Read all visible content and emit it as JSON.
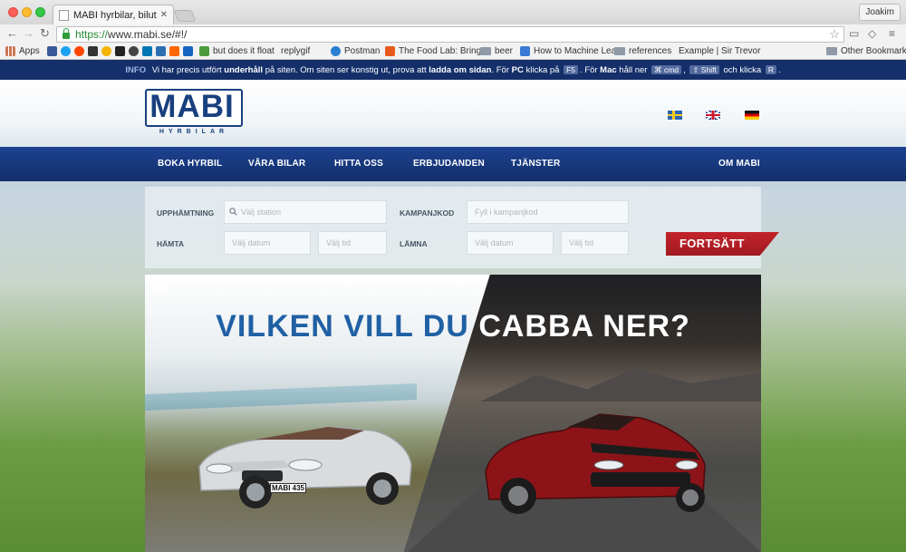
{
  "browser": {
    "tab_title": "MABI hyrbilar, biluthyrning",
    "tab_close": "✕",
    "profile": "Joakim",
    "url_scheme": "https://",
    "url_rest": "www.mabi.se/#!/",
    "bookmarks": [
      {
        "label": "Apps",
        "icon": "apps-grid-icon"
      },
      {
        "label": "but does it float",
        "icon": "float-icon"
      },
      {
        "label": "replygif",
        "icon": "page-icon"
      },
      {
        "label": "Postman",
        "icon": "postman-icon"
      },
      {
        "label": "The Food Lab: Bring",
        "icon": "food-lab-icon"
      },
      {
        "label": "beer",
        "icon": "folder-icon"
      },
      {
        "label": "How to Machine Lea",
        "icon": "page-icon"
      },
      {
        "label": "references",
        "icon": "folder-icon"
      },
      {
        "label": "Example | Sir Trevor",
        "icon": "page-icon"
      },
      {
        "label": "Other Bookmarks",
        "icon": "folder-icon"
      }
    ]
  },
  "info": {
    "tag": "INFO",
    "t1": "Vi har precis utfört",
    "b1": "underhåll",
    "t2": "på siten. Om siten ser konstig ut, prova att",
    "b2": "ladda om sidan",
    "t3": ". För",
    "b3": "PC",
    "t4": "klicka på",
    "k1": "F5",
    "t5": ". För",
    "b4": "Mac",
    "t6": "håll ner",
    "k2": "⌘ cmd",
    "t7": ",",
    "k3": "⇧ Shift",
    "t8": "och klicka",
    "k4": "R",
    "t9": "."
  },
  "logo": {
    "main": "MABI",
    "sub": "HYRBILAR"
  },
  "nav": {
    "items": [
      "BOKA HYRBIL",
      "VÅRA BILAR",
      "HITTA OSS",
      "ERBJUDANDEN",
      "TJÄNSTER"
    ],
    "about": "OM MABI"
  },
  "form": {
    "pickup_label": "UPPHÄMTNING",
    "station_placeholder": "Välj station",
    "campaign_label": "KAMPANJKOD",
    "campaign_placeholder": "Fyll i kampanjkod",
    "fetch_label": "HÄMTA",
    "date_placeholder": "Välj datum",
    "time_placeholder": "Välj tid",
    "return_label": "LÄMNA",
    "continue_label": "FORTSÄTT"
  },
  "hero": {
    "title_left": "VILKEN VILL DU",
    "title_right": "CABBA NER?",
    "plate": "MABI 435"
  },
  "colors": {
    "brand_blue": "#19407e",
    "nav_blue": "#1c4290",
    "info_bar": "#142f6a",
    "cta_red": "#c2242b"
  }
}
